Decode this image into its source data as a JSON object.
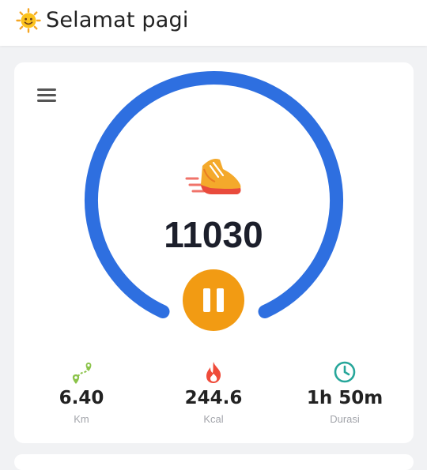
{
  "header": {
    "greeting": "Selamat pagi",
    "icon": "sun-icon"
  },
  "tracker": {
    "steps": "11030",
    "progress_ring_color": "#2e6fe0",
    "pause_button_color": "#f29b13",
    "menu_icon": "hamburger-menu-icon",
    "activity_icon": "running-shoe-icon",
    "control_icon": "pause-icon"
  },
  "stats": [
    {
      "value": "6.40",
      "unit": "Km",
      "icon": "route-pin-icon",
      "color": "#8bc34a"
    },
    {
      "value": "244.6",
      "unit": "Kcal",
      "icon": "flame-icon",
      "color": "#ef4b3a"
    },
    {
      "value": "1h 50m",
      "unit": "Durasi",
      "icon": "clock-icon",
      "color": "#26a69a"
    }
  ]
}
